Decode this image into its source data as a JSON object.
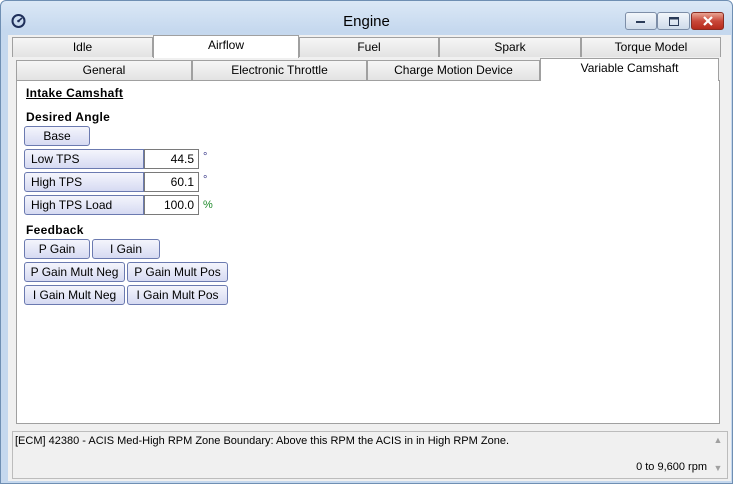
{
  "window": {
    "title": "Engine",
    "icon": "engine-app-icon",
    "controls": {
      "minimize": "minimize-icon",
      "maximize": "maximize-icon",
      "close": "close-icon"
    }
  },
  "main_tabs": [
    {
      "label": "Idle",
      "active": false
    },
    {
      "label": "Airflow",
      "active": true
    },
    {
      "label": "Fuel",
      "active": false
    },
    {
      "label": "Spark",
      "active": false
    },
    {
      "label": "Torque Model",
      "active": false
    }
  ],
  "sub_tabs": [
    {
      "label": "General",
      "active": false
    },
    {
      "label": "Electronic Throttle",
      "active": false
    },
    {
      "label": "Charge Motion Device",
      "active": false
    },
    {
      "label": "Variable Camshaft",
      "active": true
    }
  ],
  "content": {
    "section_title": "Intake Camshaft",
    "desired_angle": {
      "heading": "Desired Angle",
      "base_button": "Base",
      "params": [
        {
          "label": "Low TPS",
          "value": "44.5",
          "unit": "°"
        },
        {
          "label": "High TPS",
          "value": "60.1",
          "unit": "°"
        },
        {
          "label": "High TPS Load",
          "value": "100.0",
          "unit": "%"
        }
      ]
    },
    "feedback": {
      "heading": "Feedback",
      "buttons": [
        "P Gain",
        "I Gain",
        "P Gain Mult Neg",
        "P Gain Mult Pos",
        "I Gain Mult Neg",
        "I Gain Mult Pos"
      ]
    }
  },
  "status": {
    "description": "[ECM] 42380 - ACIS Med-High RPM Zone Boundary: Above this RPM the ACIS in in High RPM Zone.",
    "range": "0 to 9,600 rpm"
  },
  "colors": {
    "title_bar": "#c5d8ee",
    "button_border": "#6b7ab0",
    "close_button": "#c9483a",
    "percent_unit": "#1e8a2a"
  }
}
